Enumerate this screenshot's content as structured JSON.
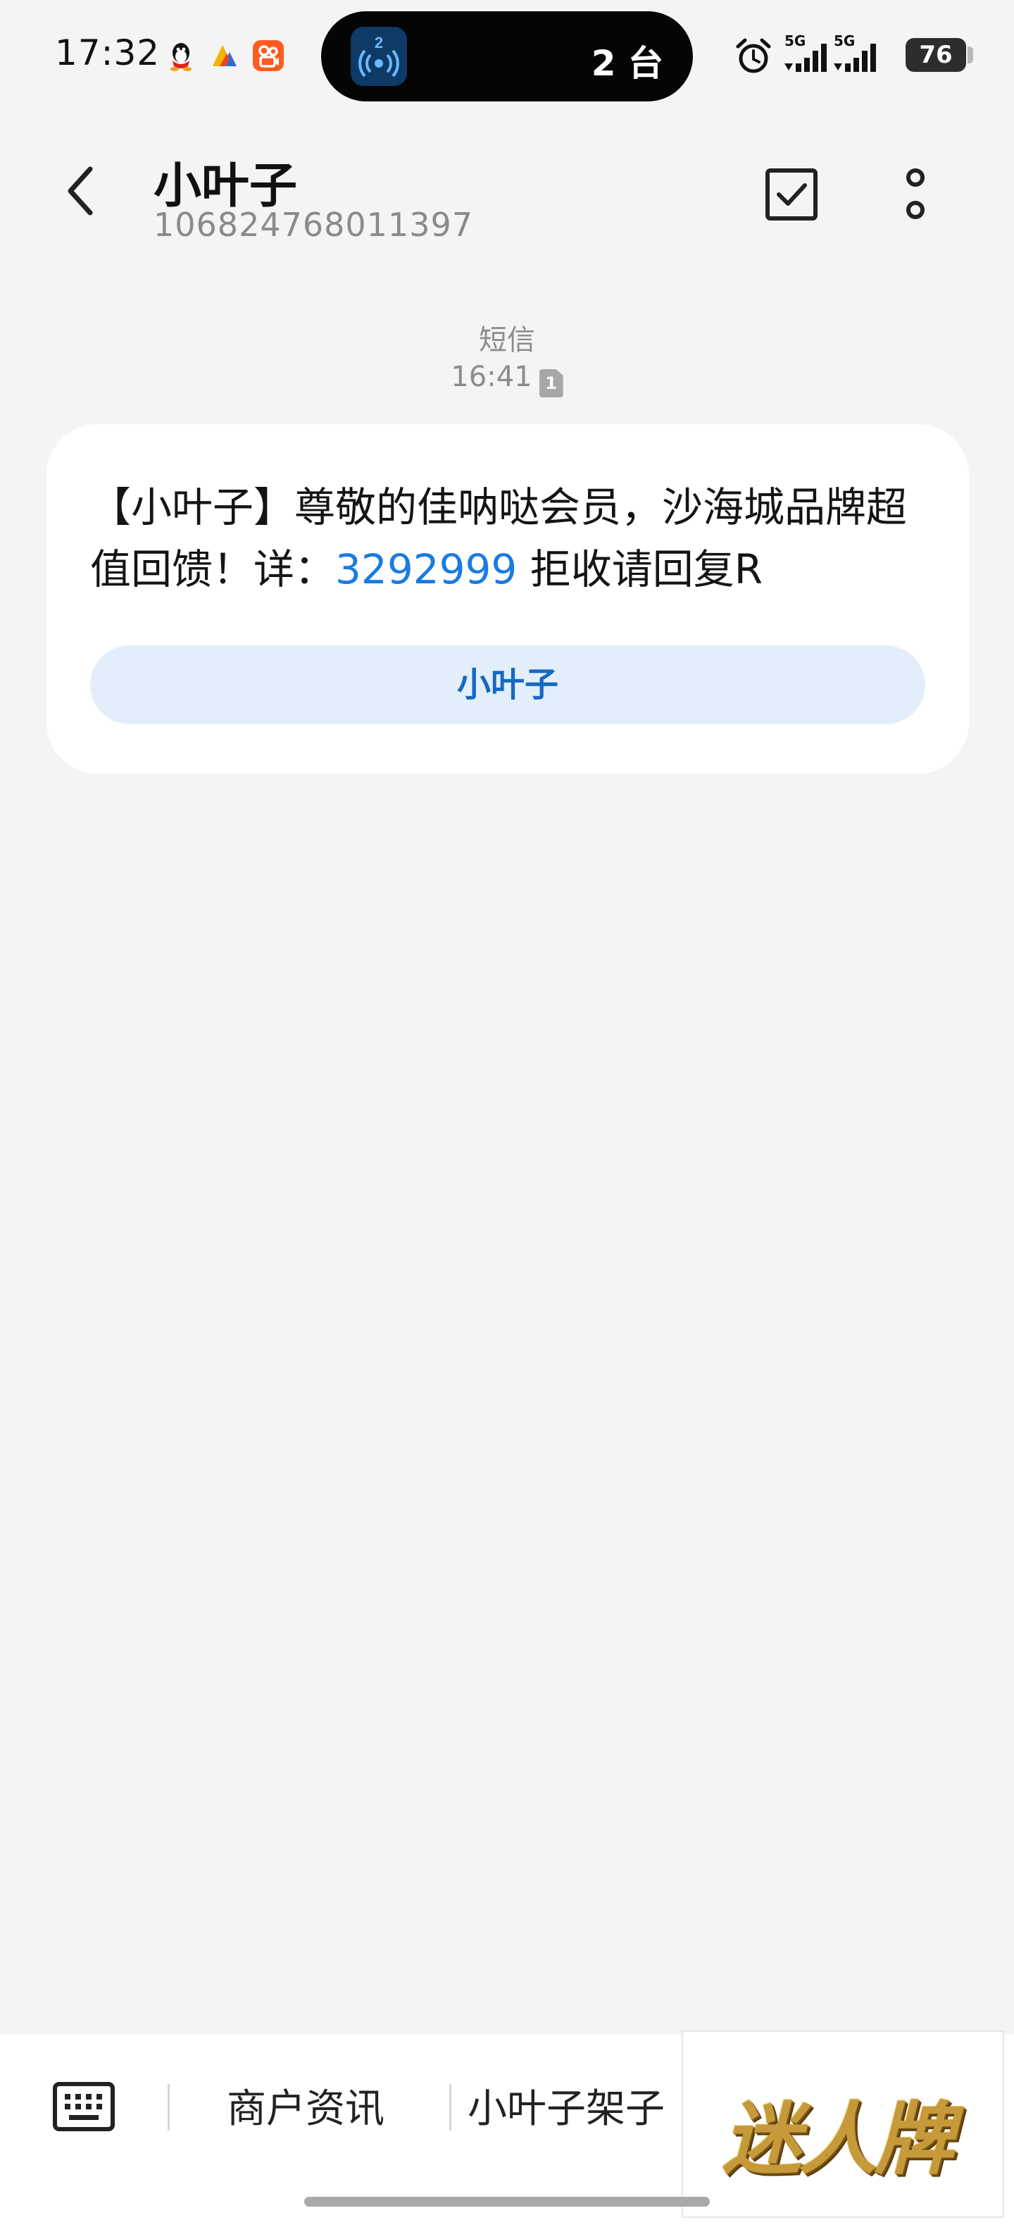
{
  "status_bar": {
    "time": "17:32",
    "notification_icons": [
      "qq-icon",
      "maps-icon",
      "kuaishou-icon"
    ],
    "island": {
      "app_icon": "hotspot-icon",
      "badge": "2",
      "text": "2 台"
    },
    "network_1": "5G",
    "network_2": "5G",
    "battery": "76"
  },
  "header": {
    "contact_name": "小叶子",
    "contact_number": "106824768011397"
  },
  "message": {
    "type_label": "短信",
    "time": "16:41",
    "sim_badge": "1",
    "text_before_link": "【小叶子】尊敬的佳呐哒会员，沙海城品牌超值回馈！详：",
    "link_text": "3292999",
    "text_after_link": " 拒收请回复R",
    "sender_chip": "小叶子"
  },
  "bottom_menu": {
    "items": [
      "商户资讯",
      "小叶子架子"
    ],
    "ad_text": "迷人牌"
  },
  "colors": {
    "background": "#f4f4f4",
    "link": "#1a7be0",
    "chip_bg": "#e2effb",
    "chip_text": "#1669c2"
  }
}
